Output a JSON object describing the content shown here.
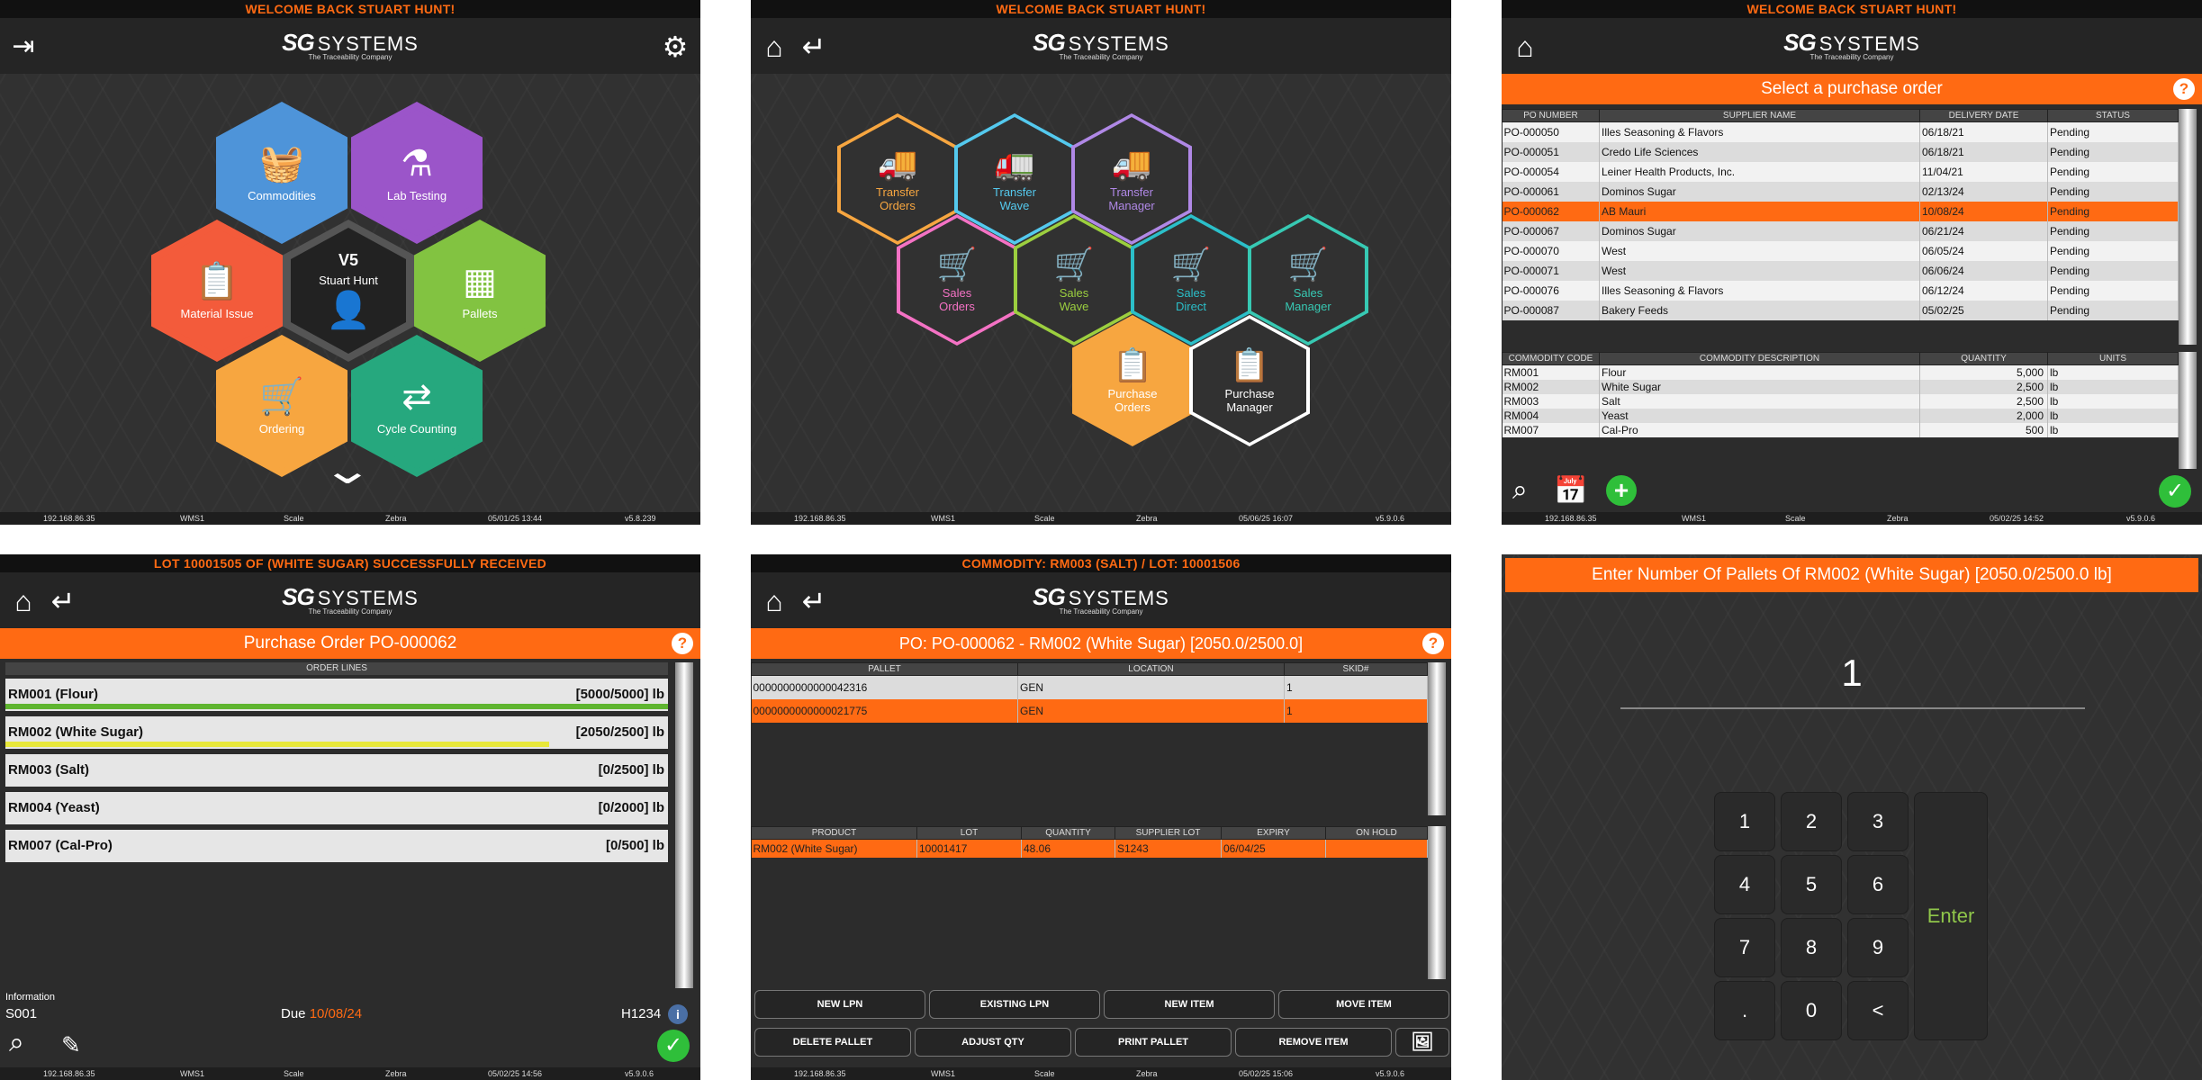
{
  "common": {
    "welcome": "WELCOME BACK STUART HUNT!",
    "logo_sg": "SG",
    "logo_systems": "SYSTEMS",
    "logo_tag": "The Traceability Company",
    "status_ip": "192.168.86.35",
    "status_wms": "WMS1",
    "status_scale": "Scale",
    "status_printer": "Zebra"
  },
  "p1": {
    "status_time": "05/01/25 13:44",
    "status_ver": "v5.8.239",
    "center_badge": "V5",
    "center_user": "Stuart Hunt",
    "hexes": [
      {
        "label": "Commodities",
        "color": "#4e94d9"
      },
      {
        "label": "Lab Testing",
        "color": "#9b55c9"
      },
      {
        "label": "Material Issue",
        "color": "#f35b3b"
      },
      {
        "label": "Pallets",
        "color": "#82c341"
      },
      {
        "label": "Ordering",
        "color": "#f7a640"
      },
      {
        "label": "Cycle Counting",
        "color": "#26a87e"
      }
    ]
  },
  "p2": {
    "status_time": "05/06/25 16:07",
    "status_ver": "v5.9.0.6",
    "hexes": [
      {
        "label1": "Transfer",
        "label2": "Orders",
        "color": "#f7a640"
      },
      {
        "label1": "Transfer",
        "label2": "Wave",
        "color": "#54c9ee"
      },
      {
        "label1": "Transfer",
        "label2": "Manager",
        "color": "#b088e6"
      },
      {
        "label1": "Sales",
        "label2": "Orders",
        "color": "#f472c4"
      },
      {
        "label1": "Sales",
        "label2": "Wave",
        "color": "#9ccf3f"
      },
      {
        "label1": "Sales",
        "label2": "Direct",
        "color": "#2bbfc9"
      },
      {
        "label1": "Sales",
        "label2": "Manager",
        "color": "#37c9b3"
      },
      {
        "label1": "Purchase",
        "label2": "Orders",
        "color": "#f7a640"
      },
      {
        "label1": "Purchase",
        "label2": "Manager",
        "color": "#ffffff"
      }
    ]
  },
  "p3": {
    "title": "Select a purchase order",
    "status_time": "05/02/25 14:52",
    "status_ver": "v5.9.0.6",
    "po_headers": [
      "PO NUMBER",
      "SUPPLIER NAME",
      "DELIVERY DATE",
      "STATUS"
    ],
    "po_rows": [
      [
        "PO-000050",
        "Illes Seasoning & Flavors",
        "06/18/21",
        "Pending"
      ],
      [
        "PO-000051",
        "Credo Life Sciences",
        "06/18/21",
        "Pending"
      ],
      [
        "PO-000054",
        "Leiner Health Products, Inc.",
        "11/04/21",
        "Pending"
      ],
      [
        "PO-000061",
        "Dominos Sugar",
        "02/13/24",
        "Pending"
      ],
      [
        "PO-000062",
        "AB Mauri",
        "10/08/24",
        "Pending"
      ],
      [
        "PO-000067",
        "Dominos Sugar",
        "06/21/24",
        "Pending"
      ],
      [
        "PO-000070",
        "West",
        "06/05/24",
        "Pending"
      ],
      [
        "PO-000071",
        "West",
        "06/06/24",
        "Pending"
      ],
      [
        "PO-000076",
        "Illes Seasoning & Flavors",
        "06/12/24",
        "Pending"
      ],
      [
        "PO-000087",
        "Bakery Feeds",
        "05/02/25",
        "Pending"
      ]
    ],
    "line_headers": [
      "COMMODITY CODE",
      "COMMODITY DESCRIPTION",
      "QUANTITY",
      "UNITS"
    ],
    "line_rows": [
      [
        "RM001",
        "Flour",
        "5,000",
        "lb"
      ],
      [
        "RM002",
        "White Sugar",
        "2,500",
        "lb"
      ],
      [
        "RM003",
        "Salt",
        "2,500",
        "lb"
      ],
      [
        "RM004",
        "Yeast",
        "2,000",
        "lb"
      ],
      [
        "RM007",
        "Cal-Pro",
        "500",
        "lb"
      ]
    ]
  },
  "p4": {
    "topmsg": "LOT 10001505 OF (WHITE SUGAR) SUCCESSFULLY RECEIVED",
    "title": "Purchase Order PO-000062",
    "list_header": "ORDER LINES",
    "lines": [
      {
        "name": "RM001 (Flour)",
        "qty": "[5000/5000] lb",
        "progress": 1.0,
        "color": "#5fb52f"
      },
      {
        "name": "RM002 (White Sugar)",
        "qty": "[2050/2500] lb",
        "progress": 0.82,
        "color": "#e8e83a"
      },
      {
        "name": "RM003 (Salt)",
        "qty": "[0/2500] lb",
        "progress": 0,
        "color": "#5fb52f"
      },
      {
        "name": "RM004 (Yeast)",
        "qty": "[0/2000] lb",
        "progress": 0,
        "color": "#5fb52f"
      },
      {
        "name": "RM007 (Cal-Pro)",
        "qty": "[0/500] lb",
        "progress": 0,
        "color": "#5fb52f"
      }
    ],
    "info_label": "Information",
    "info_left": "S001",
    "info_due_label": "Due",
    "info_due": "10/08/24",
    "info_right": "H1234",
    "status_time": "05/02/25 14:56",
    "status_ver": "v5.9.0.6"
  },
  "p5": {
    "topmsg": "COMMODITY: RM003 (SALT) / LOT: 10001506",
    "title": "PO: PO-000062 - RM002 (White Sugar) [2050.0/2500.0]",
    "pallet_headers": [
      "PALLET",
      "LOCATION",
      "SKID#"
    ],
    "pallet_rows": [
      [
        "0000000000000042316",
        "GEN",
        "1"
      ],
      [
        "0000000000000021775",
        "GEN",
        "1"
      ]
    ],
    "prod_headers": [
      "PRODUCT",
      "LOT",
      "QUANTITY",
      "SUPPLIER LOT",
      "EXPIRY",
      "ON HOLD"
    ],
    "prod_rows": [
      [
        "RM002 (White Sugar)",
        "10001417",
        "48.06",
        "S1243",
        "06/04/25",
        ""
      ]
    ],
    "buttons_row1": [
      "NEW LPN",
      "EXISTING LPN",
      "NEW ITEM",
      "MOVE ITEM"
    ],
    "buttons_row2": [
      "DELETE PALLET",
      "ADJUST QTY",
      "PRINT PALLET",
      "REMOVE ITEM"
    ],
    "status_time": "05/02/25 15:06",
    "status_ver": "v5.9.0.6"
  },
  "p6": {
    "title": "Enter Number Of Pallets Of RM002 (White Sugar) [2050.0/2500.0 lb]",
    "value": "1",
    "keys": [
      "1",
      "2",
      "3",
      "4",
      "5",
      "6",
      "7",
      "8",
      "9",
      ".",
      "0",
      "<"
    ],
    "enter": "Enter"
  }
}
